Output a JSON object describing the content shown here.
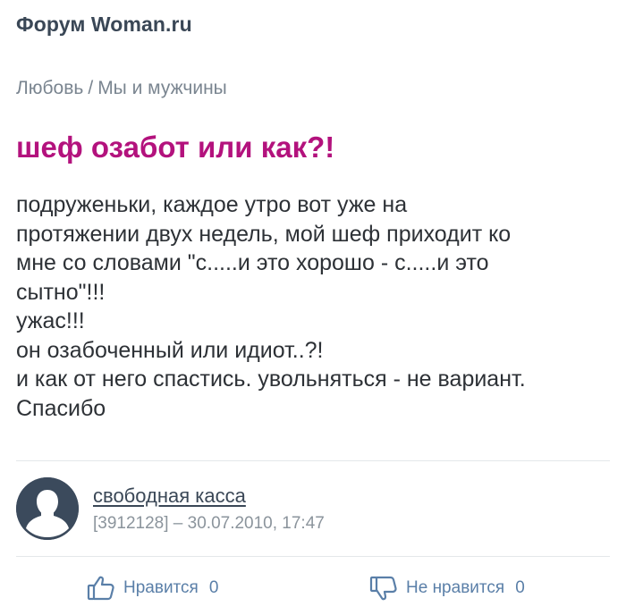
{
  "site": {
    "title": "Форум Woman.ru"
  },
  "breadcrumb": {
    "items": [
      "Любовь",
      "Мы и мужчины"
    ],
    "separator": "/"
  },
  "post": {
    "title": "шеф озабот или как?!",
    "body_lines": [
      "подруженьки, каждое утро вот уже на",
      "протяжении двух недель, мой шеф приходит ко",
      "мне со словами \"с.....и это хорошо - с.....и это",
      "сытно\"!!!",
      "ужас!!!",
      "он озабоченный или идиот..?!",
      "и как от него спастись. увольняться - не вариант.",
      "Спасибо"
    ]
  },
  "author": {
    "name": "свободная касса",
    "meta": "[3912128] – 30.07.2010, 17:47",
    "avatar_icon": "user-silhouette-icon"
  },
  "reactions": {
    "like": {
      "label": "Нравится",
      "count": "0",
      "icon": "thumbs-up-icon"
    },
    "dislike": {
      "label": "Не нравится",
      "count": "0",
      "icon": "thumbs-down-icon"
    }
  },
  "colors": {
    "title_accent": "#b3127d",
    "site_title": "#3a4756",
    "reaction": "#5a7fa8",
    "avatar_bg": "#3b4a5c"
  }
}
